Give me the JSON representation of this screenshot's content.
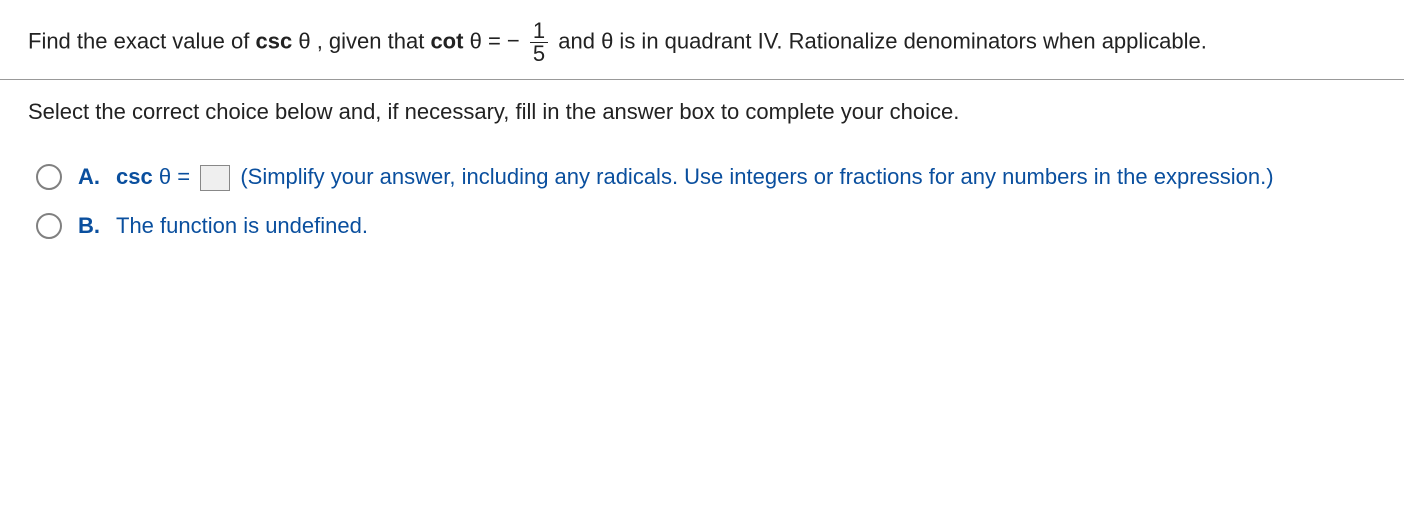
{
  "question": {
    "part1": "Find the exact value of ",
    "csc": "csc",
    "theta": "θ",
    "part2": ", given that ",
    "cot": "cot",
    "equals": " = ",
    "minus": "−",
    "frac_num": "1",
    "frac_den": "5",
    "part3": " and θ is in quadrant IV. Rationalize denominators when applicable."
  },
  "instruction": "Select the correct choice below and, if necessary, fill in the answer box to complete your choice.",
  "choices": {
    "a": {
      "letter": "A.",
      "csc": "csc",
      "theta": "θ",
      "equals": " = ",
      "hint": "(Simplify your answer, including any radicals. Use integers or fractions for any numbers in the expression.)"
    },
    "b": {
      "letter": "B.",
      "text": "The function is undefined."
    }
  }
}
